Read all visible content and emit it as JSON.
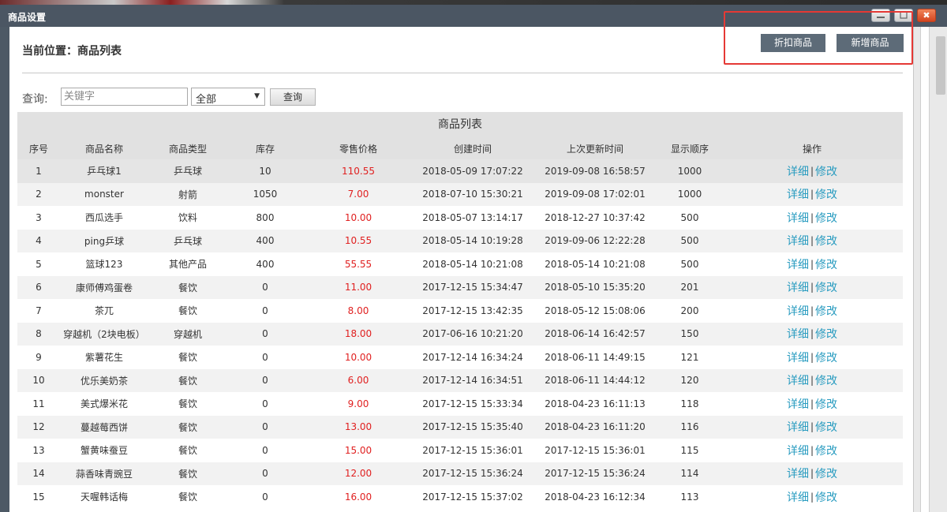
{
  "window": {
    "title": "商品设置",
    "close_glyph": "✖"
  },
  "breadcrumb": "当前位置：商品列表",
  "toolbar": {
    "discount_label": "折扣商品",
    "new_label": "新增商品"
  },
  "search": {
    "label": "查询:",
    "placeholder": "关键字",
    "type_selected": "全部",
    "button_label": "查询"
  },
  "table": {
    "caption": "商品列表",
    "columns": [
      "序号",
      "商品名称",
      "商品类型",
      "库存",
      "零售价格",
      "创建时间",
      "上次更新时间",
      "显示顺序",
      "操作"
    ],
    "detail_label": "详细",
    "edit_label": "修改",
    "separator": "|",
    "rows": [
      {
        "no": "1",
        "name": "乒乓球1",
        "type": "乒乓球",
        "stock": "10",
        "price": "110.55",
        "created": "2018-05-09 17:07:22",
        "updated": "2019-09-08 16:58:57",
        "order": "1000"
      },
      {
        "no": "2",
        "name": "monster",
        "type": "射箭",
        "stock": "1050",
        "price": "7.00",
        "created": "2018-07-10 15:30:21",
        "updated": "2019-09-08 17:02:01",
        "order": "1000"
      },
      {
        "no": "3",
        "name": "西瓜选手",
        "type": "饮料",
        "stock": "800",
        "price": "10.00",
        "created": "2018-05-07 13:14:17",
        "updated": "2018-12-27 10:37:42",
        "order": "500"
      },
      {
        "no": "4",
        "name": "ping乒球",
        "type": "乒乓球",
        "stock": "400",
        "price": "10.55",
        "created": "2018-05-14 10:19:28",
        "updated": "2019-09-06 12:22:28",
        "order": "500"
      },
      {
        "no": "5",
        "name": "篮球123",
        "type": "其他产品",
        "stock": "400",
        "price": "55.55",
        "created": "2018-05-14 10:21:08",
        "updated": "2018-05-14 10:21:08",
        "order": "500"
      },
      {
        "no": "6",
        "name": "康师傅鸡蛋卷",
        "type": "餐饮",
        "stock": "0",
        "price": "11.00",
        "created": "2017-12-15 15:34:47",
        "updated": "2018-05-10 15:35:20",
        "order": "201"
      },
      {
        "no": "7",
        "name": "茶兀",
        "type": "餐饮",
        "stock": "0",
        "price": "8.00",
        "created": "2017-12-15 13:42:35",
        "updated": "2018-05-12 15:08:06",
        "order": "200"
      },
      {
        "no": "8",
        "name": "穿越机（2块电板）",
        "type": "穿越机",
        "stock": "0",
        "price": "18.00",
        "created": "2017-06-16 10:21:20",
        "updated": "2018-06-14 16:42:57",
        "order": "150"
      },
      {
        "no": "9",
        "name": "紫薯花生",
        "type": "餐饮",
        "stock": "0",
        "price": "10.00",
        "created": "2017-12-14 16:34:24",
        "updated": "2018-06-11 14:49:15",
        "order": "121"
      },
      {
        "no": "10",
        "name": "优乐美奶茶",
        "type": "餐饮",
        "stock": "0",
        "price": "6.00",
        "created": "2017-12-14 16:34:51",
        "updated": "2018-06-11 14:44:12",
        "order": "120"
      },
      {
        "no": "11",
        "name": "美式爆米花",
        "type": "餐饮",
        "stock": "0",
        "price": "9.00",
        "created": "2017-12-15 15:33:34",
        "updated": "2018-04-23 16:11:13",
        "order": "118"
      },
      {
        "no": "12",
        "name": "蔓越莓西饼",
        "type": "餐饮",
        "stock": "0",
        "price": "13.00",
        "created": "2017-12-15 15:35:40",
        "updated": "2018-04-23 16:11:20",
        "order": "116"
      },
      {
        "no": "13",
        "name": "蟹黄味蚕豆",
        "type": "餐饮",
        "stock": "0",
        "price": "15.00",
        "created": "2017-12-15 15:36:01",
        "updated": "2017-12-15 15:36:01",
        "order": "115"
      },
      {
        "no": "14",
        "name": "蒜香味青豌豆",
        "type": "餐饮",
        "stock": "0",
        "price": "12.00",
        "created": "2017-12-15 15:36:24",
        "updated": "2017-12-15 15:36:24",
        "order": "114"
      },
      {
        "no": "15",
        "name": "天喔韩话梅",
        "type": "餐饮",
        "stock": "0",
        "price": "16.00",
        "created": "2017-12-15 15:37:02",
        "updated": "2018-04-23 16:12:34",
        "order": "113"
      }
    ]
  },
  "colors": {
    "price": "#e02020",
    "link": "#2a9cc0",
    "titlebar": "#4b5663",
    "button": "#5d6b78",
    "highlight": "#e53935"
  }
}
